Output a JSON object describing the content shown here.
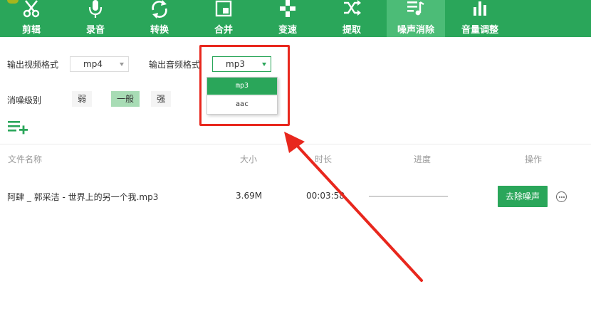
{
  "toolbar": {
    "items": [
      {
        "label": "剪辑",
        "icon": "scissors-icon"
      },
      {
        "label": "录音",
        "icon": "microphone-icon"
      },
      {
        "label": "转换",
        "icon": "convert-arrows-icon"
      },
      {
        "label": "合并",
        "icon": "merge-window-icon"
      },
      {
        "label": "变速",
        "icon": "gamepad-icon"
      },
      {
        "label": "提取",
        "icon": "shuffle-icon"
      },
      {
        "label": "噪声消除",
        "icon": "music-list-icon"
      },
      {
        "label": "音量调整",
        "icon": "bar-chart-icon"
      }
    ],
    "active_index": 6
  },
  "settings": {
    "video_format_label": "输出视频格式",
    "video_format_value": "mp4",
    "audio_format_label": "输出音频格式",
    "audio_format_value": "mp3",
    "audio_format_options": [
      "mp3",
      "aac"
    ],
    "noise_level_label": "消噪级别",
    "noise_levels": [
      "弱",
      "一般",
      "强"
    ],
    "noise_level_selected": "一般"
  },
  "table": {
    "headers": {
      "name": "文件名称",
      "size": "大小",
      "duration": "时长",
      "progress": "进度",
      "action": "操作"
    },
    "rows": [
      {
        "name": "阿肆 _ 郭采洁 - 世界上的另一个我.mp3",
        "size": "3.69M",
        "duration": "00:03:58",
        "progress": 0,
        "action_label": "去除噪声"
      }
    ]
  },
  "colors": {
    "accent": "#2aa65a",
    "active_tab": "#4cbc77",
    "highlight": "#e8271d"
  }
}
